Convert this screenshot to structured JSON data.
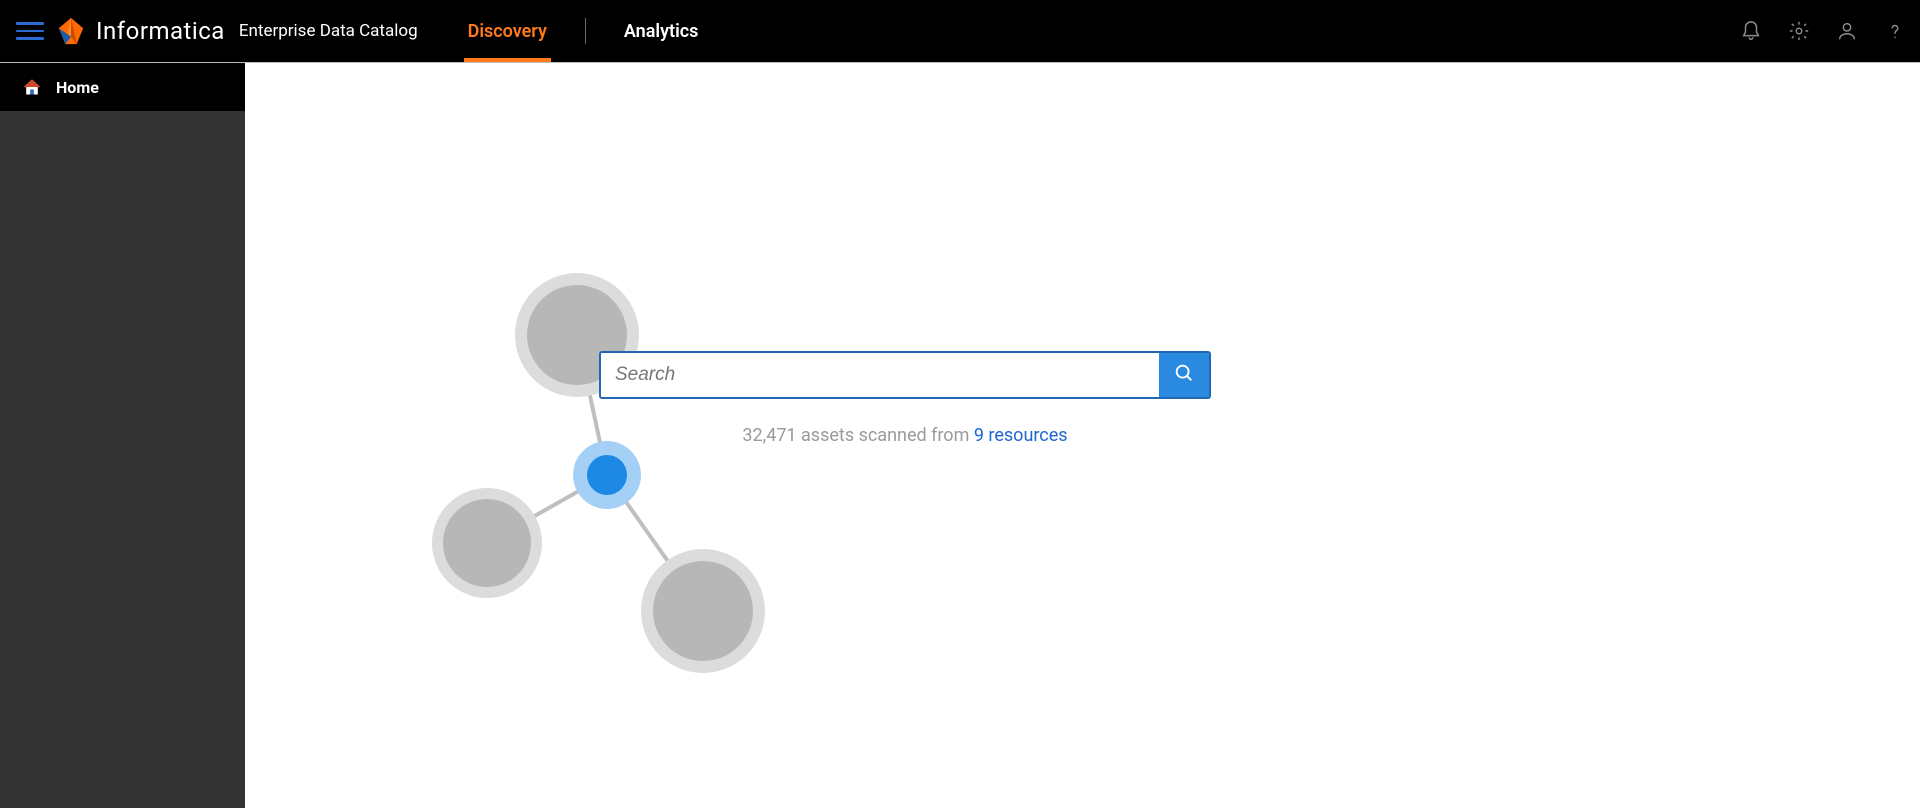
{
  "header": {
    "brand": "Informatica",
    "product": "Enterprise Data Catalog",
    "tabs": [
      {
        "label": "Discovery",
        "active": true
      },
      {
        "label": "Analytics",
        "active": false
      }
    ]
  },
  "sidebar": {
    "items": [
      {
        "label": "Home"
      }
    ]
  },
  "search": {
    "placeholder": "Search"
  },
  "stats": {
    "count": "32,471",
    "scanned_text": " assets scanned from ",
    "resource_count": "9 resources"
  }
}
